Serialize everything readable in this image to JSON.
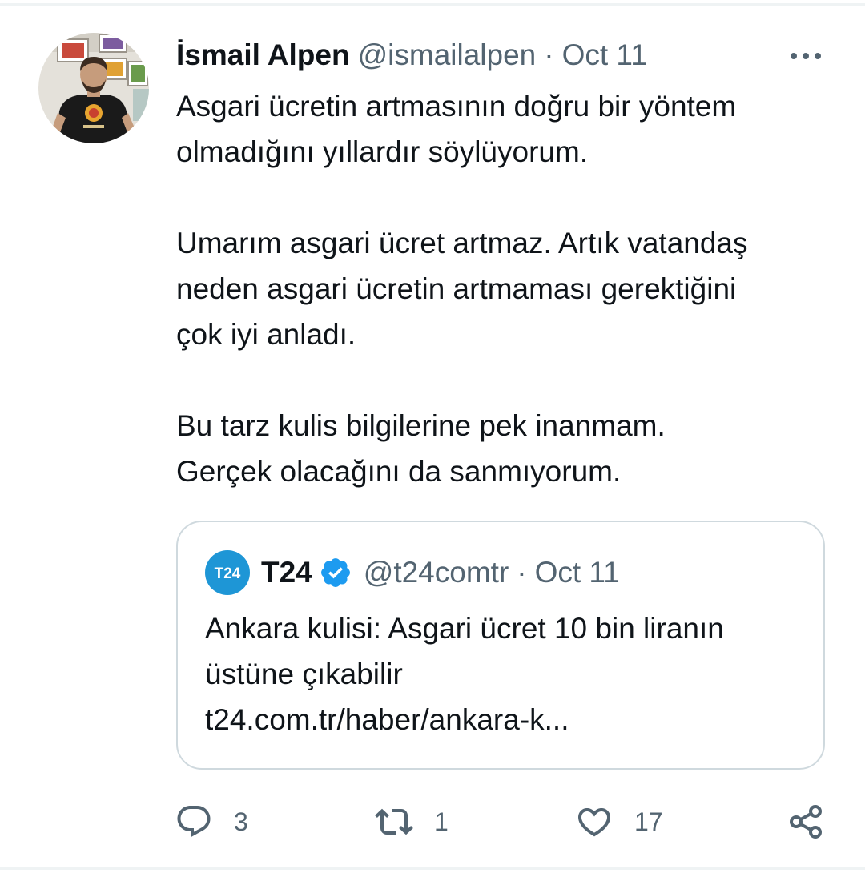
{
  "tweet": {
    "author_name": "İsmail Alpen",
    "author_handle": "@ismailalpen",
    "separator": "·",
    "date": "Oct 11",
    "avatar_icon": "profile-photo",
    "more_icon": "more-dots-icon",
    "paragraphs": [
      [
        "Asgari ücretin artmasının doğru bir yöntem",
        "olmadığını yıllardır söylüyorum."
      ],
      [
        "Umarım asgari ücret artmaz. Artık vatandaş",
        "neden asgari ücretin artmaması gerektiğini",
        "çok iyi anladı."
      ],
      [
        "Bu tarz kulis bilgilerine pek inanmam.",
        "Gerçek olacağını da sanmıyorum."
      ]
    ]
  },
  "quote": {
    "author_name": "T24",
    "avatar_text": "T24",
    "author_handle": "@t24comtr",
    "separator": "·",
    "date": "Oct 11",
    "verified_icon": "verified-badge-icon",
    "lines": [
      "Ankara kulisi: Asgari ücret 10 bin liranın",
      "üstüne çıkabilir",
      "t24.com.tr/haber/ankara-k..."
    ]
  },
  "actions": {
    "reply": {
      "icon": "reply-icon",
      "count": "3"
    },
    "retweet": {
      "icon": "retweet-icon",
      "count": "1"
    },
    "like": {
      "icon": "heart-icon",
      "count": "17"
    },
    "share": {
      "icon": "share-icon"
    }
  },
  "colors": {
    "text": "#0f1419",
    "secondary": "#536471",
    "border": "#cfd9de",
    "verified": "#1d9bf0",
    "t24_brand": "#1e96d6"
  }
}
